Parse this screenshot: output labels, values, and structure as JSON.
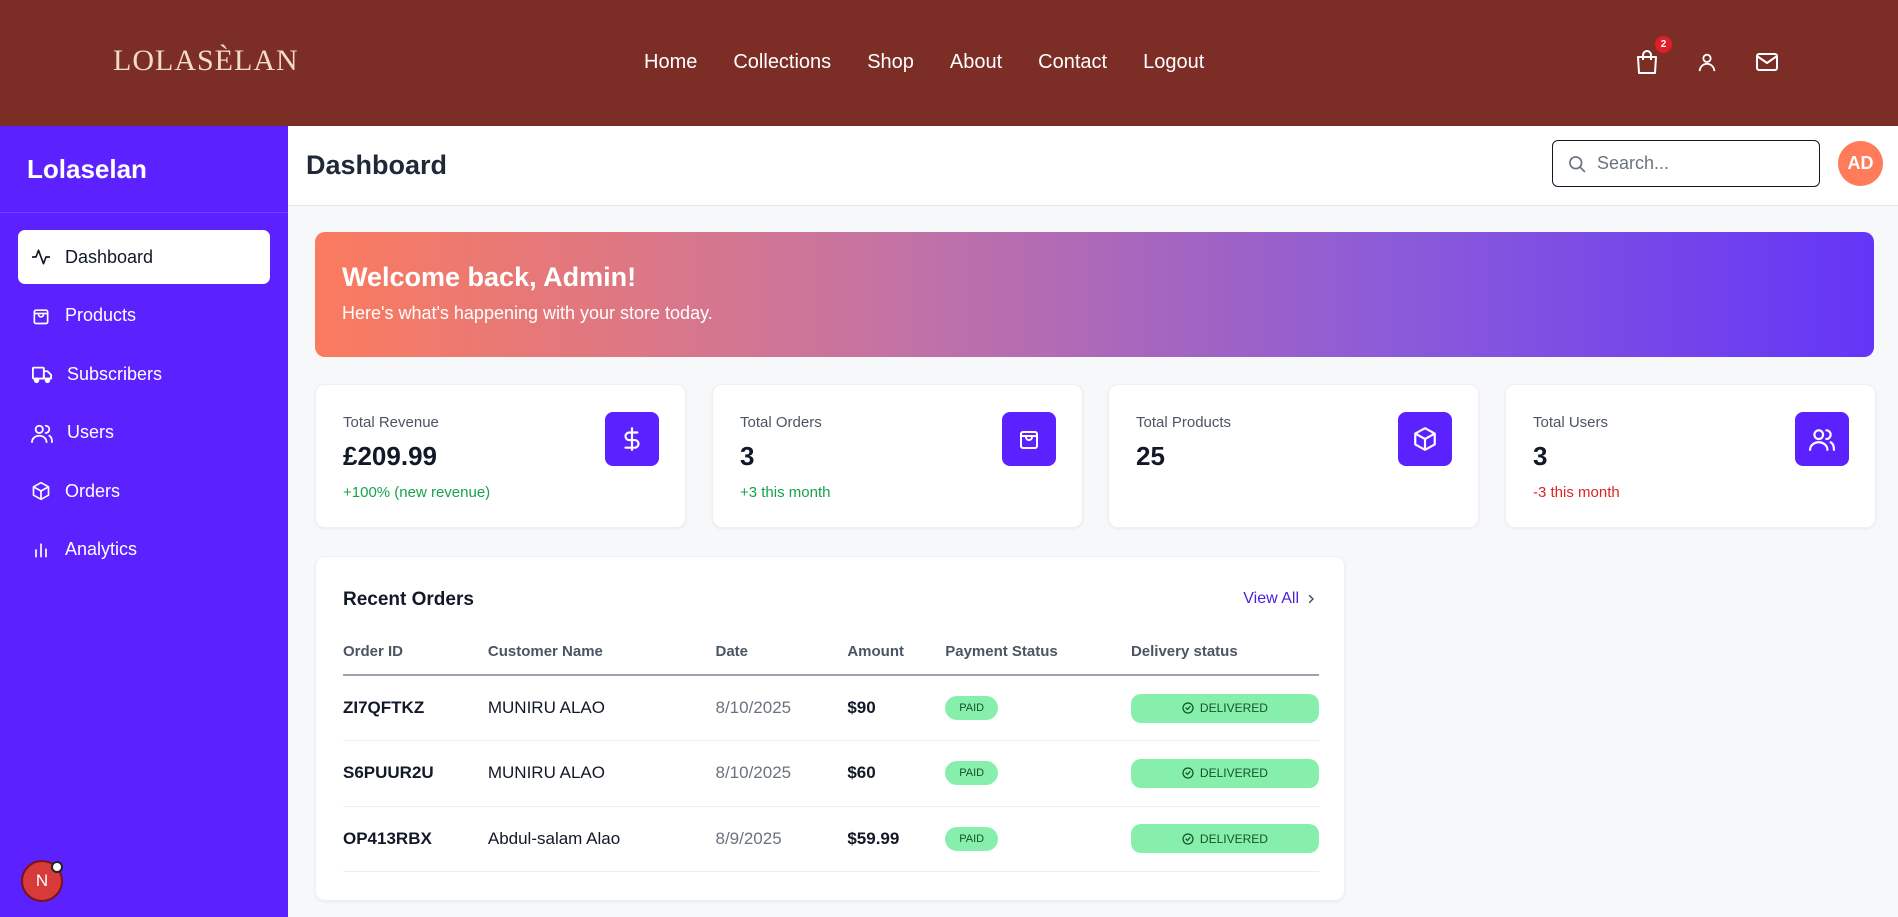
{
  "topbar": {
    "logo": "LOLASÈLAN",
    "nav": [
      "Home",
      "Collections",
      "Shop",
      "About",
      "Contact",
      "Logout"
    ],
    "cart_count": "2"
  },
  "sidebar": {
    "brand": "Lolaselan",
    "items": [
      {
        "label": "Dashboard",
        "icon": "activity-icon"
      },
      {
        "label": "Products",
        "icon": "shopping-bag-icon"
      },
      {
        "label": "Subscribers",
        "icon": "truck-icon"
      },
      {
        "label": "Users",
        "icon": "users-icon"
      },
      {
        "label": "Orders",
        "icon": "package-icon"
      },
      {
        "label": "Analytics",
        "icon": "bar-chart-icon"
      }
    ],
    "dev_badge": "N"
  },
  "header": {
    "title": "Dashboard",
    "search_placeholder": "Search...",
    "avatar_initials": "AD"
  },
  "welcome": {
    "title": "Welcome back, Admin!",
    "subtitle": "Here's what's happening with your store today."
  },
  "stats": [
    {
      "label": "Total Revenue",
      "value": "£209.99",
      "delta": "+100% (new revenue)",
      "icon": "dollar-icon"
    },
    {
      "label": "Total Orders",
      "value": "3",
      "delta": "+3 this month",
      "icon": "shopping-bag-icon"
    },
    {
      "label": "Total Products",
      "value": "25",
      "delta": "",
      "icon": "package-icon"
    },
    {
      "label": "Total Users",
      "value": "3",
      "delta": "-3 this month",
      "icon": "users-icon"
    }
  ],
  "orders": {
    "title": "Recent Orders",
    "view_all": "View All",
    "columns": [
      "Order ID",
      "Customer Name",
      "Date",
      "Amount",
      "Payment Status",
      "Delivery status"
    ],
    "rows": [
      {
        "id": "ZI7QFTKZ",
        "customer": "MUNIRU ALAO",
        "date": "8/10/2025",
        "amount": "$90",
        "payment": "PAID",
        "delivery": "DELIVERED"
      },
      {
        "id": "S6PUUR2U",
        "customer": "MUNIRU ALAO",
        "date": "8/10/2025",
        "amount": "$60",
        "payment": "PAID",
        "delivery": "DELIVERED"
      },
      {
        "id": "OP413RBX",
        "customer": "Abdul-salam Alao",
        "date": "8/9/2025",
        "amount": "$59.99",
        "payment": "PAID",
        "delivery": "DELIVERED"
      }
    ]
  },
  "colors": {
    "topbar": "#7b2d26",
    "sidebar": "#5b21ff",
    "accent": "#5b21ff",
    "success": "#16a34a",
    "danger": "#dc2626",
    "status_green": "#86efac"
  }
}
